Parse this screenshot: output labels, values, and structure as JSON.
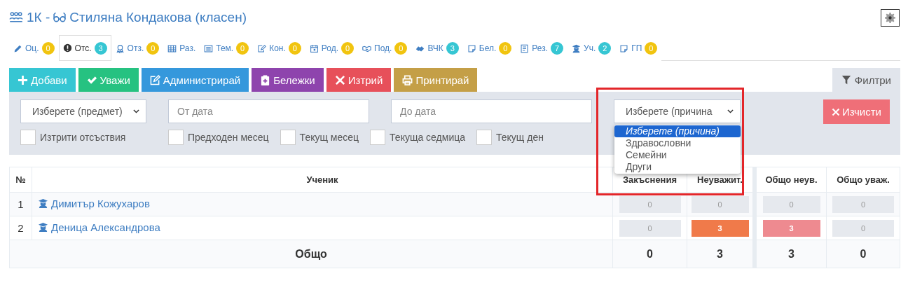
{
  "header": {
    "class_name": "1К -",
    "teacher": "Стиляна Кондакова (класен)"
  },
  "tabs": [
    {
      "label": "Оц.",
      "count": "0",
      "color": "#f1c40f",
      "selected": false
    },
    {
      "label": "Отс.",
      "count": "3",
      "color": "#36c6d3",
      "selected": true
    },
    {
      "label": "Отз.",
      "count": "0",
      "color": "#f1c40f",
      "selected": false
    },
    {
      "label": "Раз.",
      "selected": false
    },
    {
      "label": "Тем.",
      "count": "0",
      "color": "#f1c40f",
      "selected": false
    },
    {
      "label": "Кон.",
      "count": "0",
      "color": "#f1c40f",
      "selected": false
    },
    {
      "label": "Род.",
      "count": "0",
      "color": "#f1c40f",
      "selected": false
    },
    {
      "label": "Под.",
      "count": "0",
      "color": "#f1c40f",
      "selected": false
    },
    {
      "label": "ВЧК",
      "count": "3",
      "color": "#36c6d3",
      "selected": false
    },
    {
      "label": "Бел.",
      "count": "0",
      "color": "#f1c40f",
      "selected": false
    },
    {
      "label": "Рез.",
      "count": "7",
      "color": "#36c6d3",
      "selected": false
    },
    {
      "label": "Уч.",
      "count": "2",
      "color": "#36c6d3",
      "selected": false
    },
    {
      "label": "ГП",
      "count": "0",
      "color": "#f1c40f",
      "selected": false
    }
  ],
  "toolbar": {
    "buttons": [
      {
        "label": "Добави",
        "color": "#36c6d3"
      },
      {
        "label": "Уважи",
        "color": "#26c281"
      },
      {
        "label": "Администрирай",
        "color": "#3598dc"
      },
      {
        "label": "Бележки",
        "color": "#8e44ad"
      },
      {
        "label": "Изтрий",
        "color": "#e7505a"
      },
      {
        "label": "Принтирай",
        "color": "#c49f47"
      }
    ],
    "filters_tab": {
      "label": "Филтри",
      "selected": true
    }
  },
  "filters": {
    "subject_select": {
      "value": "Изберете (предмет)"
    },
    "from_date": {
      "placeholder": "От дата"
    },
    "to_date": {
      "placeholder": "До дата"
    },
    "reason_select": {
      "value": "Изберете (причина",
      "expanded": true,
      "highlighted": true,
      "options": [
        {
          "label": "Изберете (причина)",
          "selected": true
        },
        {
          "label": "Здравословни",
          "selected": false
        },
        {
          "label": "Семейни",
          "selected": false
        },
        {
          "label": "Други",
          "selected": false
        }
      ]
    },
    "clear_button": "Изчисти",
    "checkboxes": [
      {
        "label": "Изтрити отсъствия",
        "checked": false
      },
      {
        "label": "Предходен месец",
        "checked": false
      },
      {
        "label": "Текущ месец",
        "checked": false
      },
      {
        "label": "Текуща седмица",
        "checked": false
      },
      {
        "label": "Текущ ден",
        "checked": false
      }
    ]
  },
  "table": {
    "columns": [
      "№",
      "Ученик",
      "Закъснения",
      "Неуважит.",
      "Общо неув.",
      "Общо уваж."
    ],
    "rows": [
      {
        "cells": [
          {
            "kind": "number",
            "value": "1"
          },
          {
            "kind": "link",
            "value": "Димитър Кожухаров"
          },
          {
            "kind": "count",
            "value": "0",
            "color": "#e6e9ee"
          },
          {
            "kind": "count",
            "value": "0",
            "color": "#e6e9ee"
          },
          {
            "kind": "count",
            "value": "0",
            "color": "#e6e9ee"
          },
          {
            "kind": "count",
            "value": "0",
            "color": "#e6e9ee"
          }
        ]
      },
      {
        "cells": [
          {
            "kind": "number",
            "value": "2"
          },
          {
            "kind": "link",
            "value": "Деница Александрова"
          },
          {
            "kind": "count",
            "value": "0",
            "color": "#e6e9ee"
          },
          {
            "kind": "count",
            "value": "3",
            "color": "#f07a4a"
          },
          {
            "kind": "count",
            "value": "3",
            "color": "#ee8a90"
          },
          {
            "kind": "count",
            "value": "0",
            "color": "#e6e9ee"
          }
        ]
      },
      {
        "cells": [
          {
            "kind": "total",
            "value": "Общо",
            "colspan": 2
          },
          {
            "kind": "total",
            "value": "0"
          },
          {
            "kind": "total",
            "value": "3"
          },
          {
            "kind": "total",
            "value": "3"
          },
          {
            "kind": "total",
            "value": "0"
          }
        ]
      }
    ]
  }
}
